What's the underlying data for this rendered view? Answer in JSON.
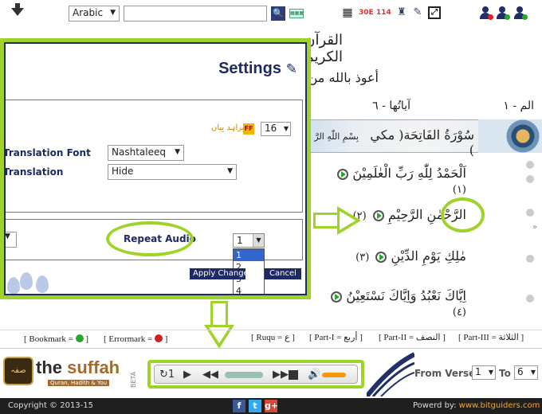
{
  "toolbar": {
    "language": "Arabic",
    "search_placeholder": "",
    "search_btn": "🔍",
    "icon_30e": "30E",
    "icon_114": "114"
  },
  "quran": {
    "title": "القرآن الكريم",
    "audhu": "أعوذ بالله من",
    "verses_count": "آياتُها - ٦",
    "juz_label": "الم - ١",
    "surah_name": "سُوْرَةُ الفَاتِحَة( مكي )",
    "bismillah": "بِسْمِ اللّٰهِ الرَّ",
    "verses": [
      {
        "num": "(١)",
        "text": "اَلْحَمْدُ لِلّٰهِ رَبِّ الْعٰلَمِيْنَ"
      },
      {
        "num": "(٢)",
        "text": "الرَّحْمٰنِ الرَّحِيْمِ"
      },
      {
        "num": "(٣)",
        "text": "مٰلِكِ يَوْمِ الدِّيْنِ"
      },
      {
        "num": "(٤)",
        "text": "اِيَّاكَ نَعْبُدُ وَاِيَّاكَ نَسْتَعِيْنُ"
      }
    ]
  },
  "settings": {
    "title": "Settings",
    "font_size": "16",
    "ff_badge": "FF",
    "urdu_sample": "بِزاہِد بِیان",
    "translation_font_label": "Translation Font",
    "translation_font_value": "Nashtaleeq",
    "translation_label": "Translation",
    "translation_value": "Hide",
    "repeat_audio_label": "Repeat Audio",
    "repeat_value": "1",
    "repeat_options": [
      "1",
      "2",
      "3",
      "4"
    ],
    "apply_label": "Apply Changes",
    "cancel_label": "Cancel"
  },
  "legend": {
    "bookmark": "[ Bookmark = ",
    "bookmark_end": " ]",
    "errormark": "[ Errormark = ",
    "errormark_end": " ]",
    "ruqu": "[ Ruqu = ع ]",
    "part1": "[ Part-I = أربع ]",
    "part2": "[ Part-II = النصف ]",
    "part3": "[ Part-III = الثلاثة ]",
    "bookmark_color": "#2aa52a",
    "errormark_color": "#cc2222"
  },
  "logo": {
    "emblem": "صفہ",
    "text_the": "the ",
    "text_suffah": "suffah",
    "tagline": "Quran, Hadith & You",
    "beta": "BETA"
  },
  "player": {
    "repeat_count": "1",
    "progress": 0.0,
    "volume": 0.8
  },
  "verse_range": {
    "from_label": "From Verse",
    "from_value": "1",
    "to_label": "To",
    "to_value": "6"
  },
  "footer": {
    "copyright": "Copyright © 2013-15",
    "powered_prefix": "Powerd by: ",
    "powered_link": "www.bitguiders.com"
  },
  "colors": {
    "highlight": "#9fd32a",
    "dialog_navy": "#1d2a63"
  }
}
